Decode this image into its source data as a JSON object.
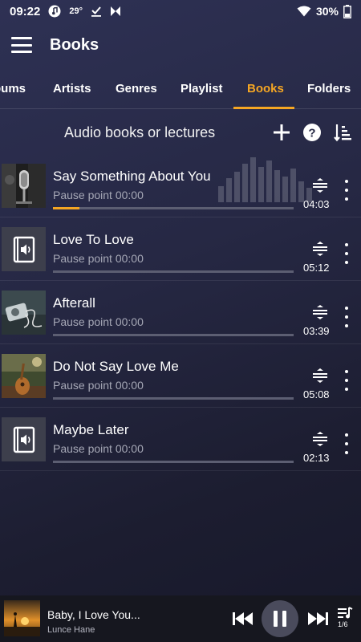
{
  "status_bar": {
    "time": "09:22",
    "temperature": "29°",
    "battery": "30%"
  },
  "header": {
    "title": "Books"
  },
  "tabs": [
    {
      "label": "bums",
      "active": false
    },
    {
      "label": "Artists",
      "active": false
    },
    {
      "label": "Genres",
      "active": false
    },
    {
      "label": "Playlist",
      "active": false
    },
    {
      "label": "Books",
      "active": true
    },
    {
      "label": "Folders",
      "active": false
    }
  ],
  "section": {
    "title": "Audio books or lectures"
  },
  "books": [
    {
      "title": "Say Something About You",
      "pause_point": "Pause point 00:00",
      "duration": "04:03",
      "progress": 0.11,
      "thumb": "microphone"
    },
    {
      "title": "Love To Love",
      "pause_point": "Pause point 00:00",
      "duration": "05:12",
      "progress": 0.0,
      "thumb": "audiobook"
    },
    {
      "title": "Afterall",
      "pause_point": "Pause point 00:00",
      "duration": "03:39",
      "progress": 0.0,
      "thumb": "player"
    },
    {
      "title": "Do Not Say Love Me",
      "pause_point": "Pause point 00:00",
      "duration": "05:08",
      "progress": 0.0,
      "thumb": "guitar"
    },
    {
      "title": "Maybe Later",
      "pause_point": "Pause point 00:00",
      "duration": "02:13",
      "progress": 0.0,
      "thumb": "audiobook"
    }
  ],
  "mini_player": {
    "title": "Baby, I Love You...",
    "artist": "Lunce Hane",
    "queue": "1/6",
    "state": "playing"
  },
  "colors": {
    "accent": "#f5a623",
    "background": "#262844",
    "track": "#5c5e72"
  }
}
